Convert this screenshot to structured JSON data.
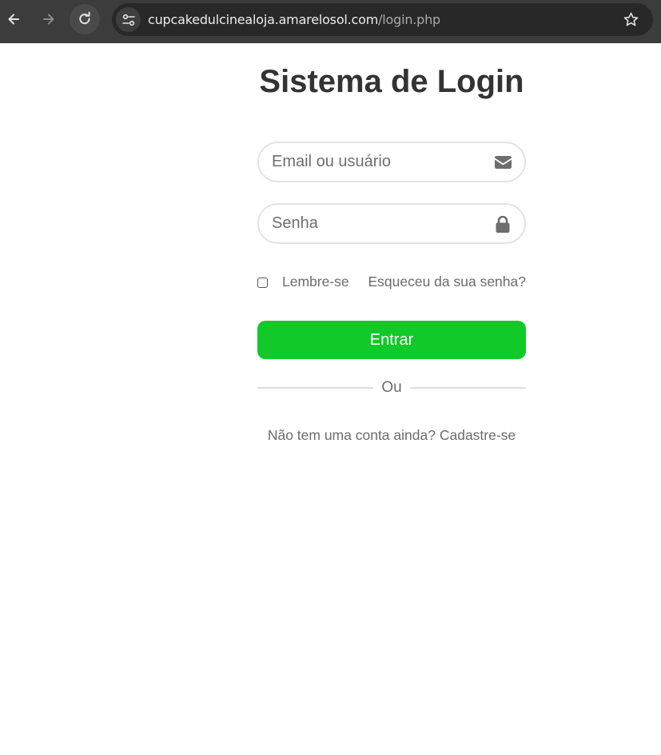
{
  "browser": {
    "url_host": "cupcakedulcinealoja.amarelosol.com",
    "url_path": "/login.php",
    "icons": {
      "back": "back-arrow-icon",
      "forward": "forward-arrow-icon",
      "reload": "reload-icon",
      "site_info": "site-settings-icon",
      "bookmark": "star-icon"
    }
  },
  "login": {
    "title": "Sistema de Login",
    "email_placeholder": "Email ou usuário",
    "email_icon": "envelope-icon",
    "password_placeholder": "Senha",
    "password_icon": "lock-icon",
    "remember_label": "Lembre-se",
    "forgot_link": "Esqueceu da sua senha?",
    "submit_label": "Entrar",
    "divider_text": "Ou",
    "signup_text": "Não tem uma conta ainda?",
    "signup_link": "Cadastre-se"
  },
  "colors": {
    "chrome_bg": "#3c3c3c",
    "omnibox_bg": "#282828",
    "accent_green": "#12c92a",
    "title_text": "#333333",
    "muted_text": "#6c6c6c"
  }
}
